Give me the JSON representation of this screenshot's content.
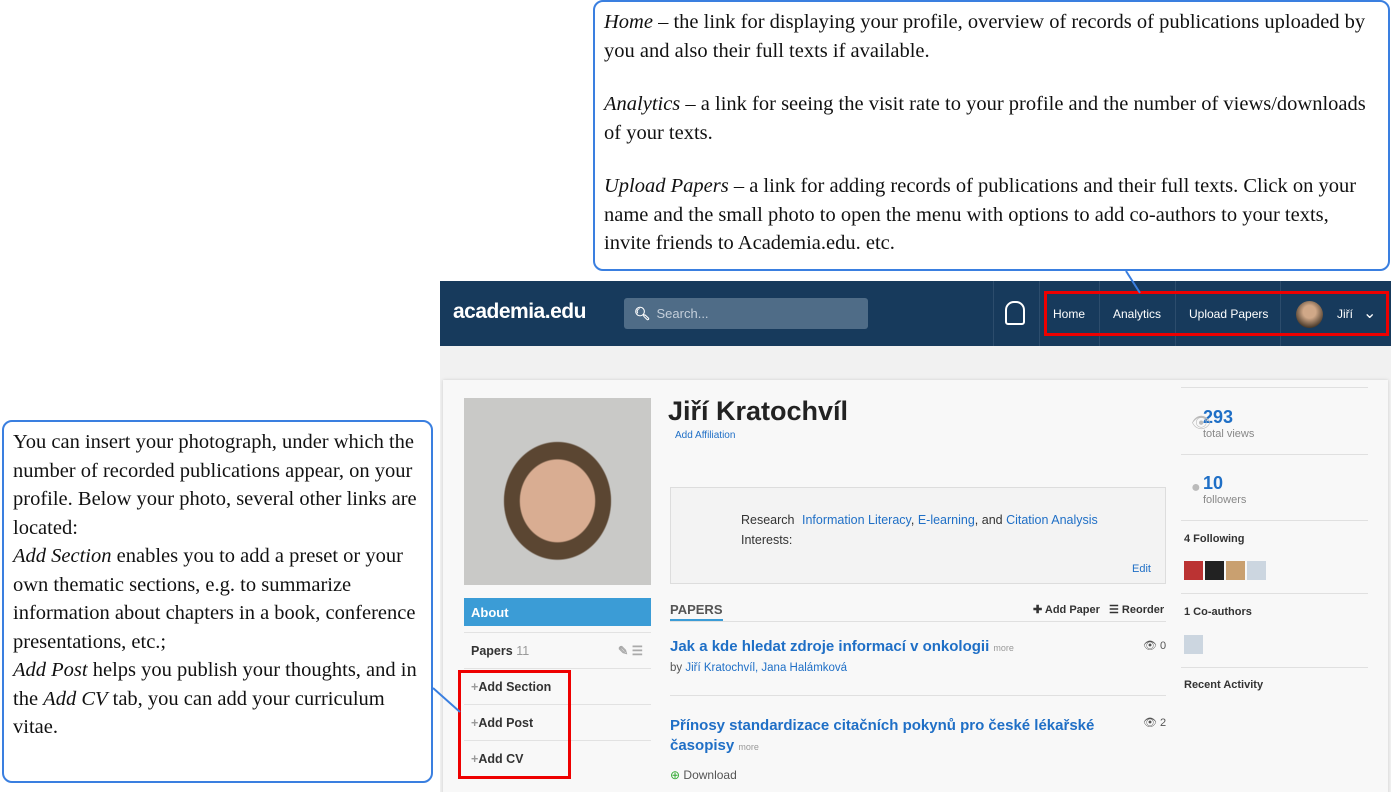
{
  "callouts": {
    "top": [
      {
        "term": "Home",
        "text": " – the link for displaying your profile, overview of records of publications uploaded by you and also their full texts if available."
      },
      {
        "term": "Analytics",
        "text": " – a link for seeing the visit rate to your profile and the number of views/downloads of your texts."
      },
      {
        "term": "Upload Papers",
        "text": " – a link for adding records of publications and their full texts. Click on your name and the small photo to open the menu with options to add co-authors to your texts, invite friends to Academia.edu. etc."
      }
    ],
    "left": {
      "intro": "You can insert your photograph, under which the number of recorded publications appear, on your profile. Below your photo, several other links are located:",
      "t1": "Add Section",
      "s1": " enables you to add a preset or your own thematic sections, e.g. to summarize information about chapters in a book, conference presentations, etc.;",
      "t2": "Add Post",
      "s2": " helps you publish your thoughts, and in the ",
      "t3": "Add CV",
      "s3": " tab, you can add your curriculum vitae."
    }
  },
  "header": {
    "logo": "academia.edu",
    "search_placeholder": "Search...",
    "nav": [
      "Home",
      "Analytics",
      "Upload Papers"
    ],
    "user": "Jiří"
  },
  "profile": {
    "name": "Jiří Kratochvíl",
    "add_affiliation": "Add Affiliation",
    "interests_label1": "Research",
    "interests_label2": "Interests:",
    "interest1": "Information Literacy",
    "sep1": ", ",
    "interest2": "E-learning",
    "sep2": ", and ",
    "interest3": "Citation Analysis",
    "edit": "Edit"
  },
  "sidebar": {
    "about": "About",
    "papers": "Papers",
    "papers_count": "11",
    "add_section": "Add Section",
    "add_post": "Add Post",
    "add_cv": "Add CV"
  },
  "papers": {
    "heading": "PAPERS",
    "add_paper": "Add Paper",
    "reorder": "Reorder",
    "more": "more",
    "items": [
      {
        "title": "Jak a kde hledat zdroje informací v onkologii",
        "by": "by",
        "authors": "Jiří Kratochvíl, Jana Halámková",
        "views": "0"
      },
      {
        "title": "Přínosy standardizace citačních pokynů pro české lékařské časopisy",
        "views": "2",
        "download": "Download"
      }
    ]
  },
  "stats": {
    "views": "293",
    "views_label": "total views",
    "followers": "10",
    "followers_label": "followers",
    "following": "4 Following",
    "coauthors": "1 Co-authors",
    "recent": "Recent Activity"
  },
  "colors": {
    "header": "#173a5c",
    "accent": "#3b9cd6",
    "link": "#1f6fc6",
    "callout_border": "#3a7fe0",
    "highlight": "#e00000"
  }
}
